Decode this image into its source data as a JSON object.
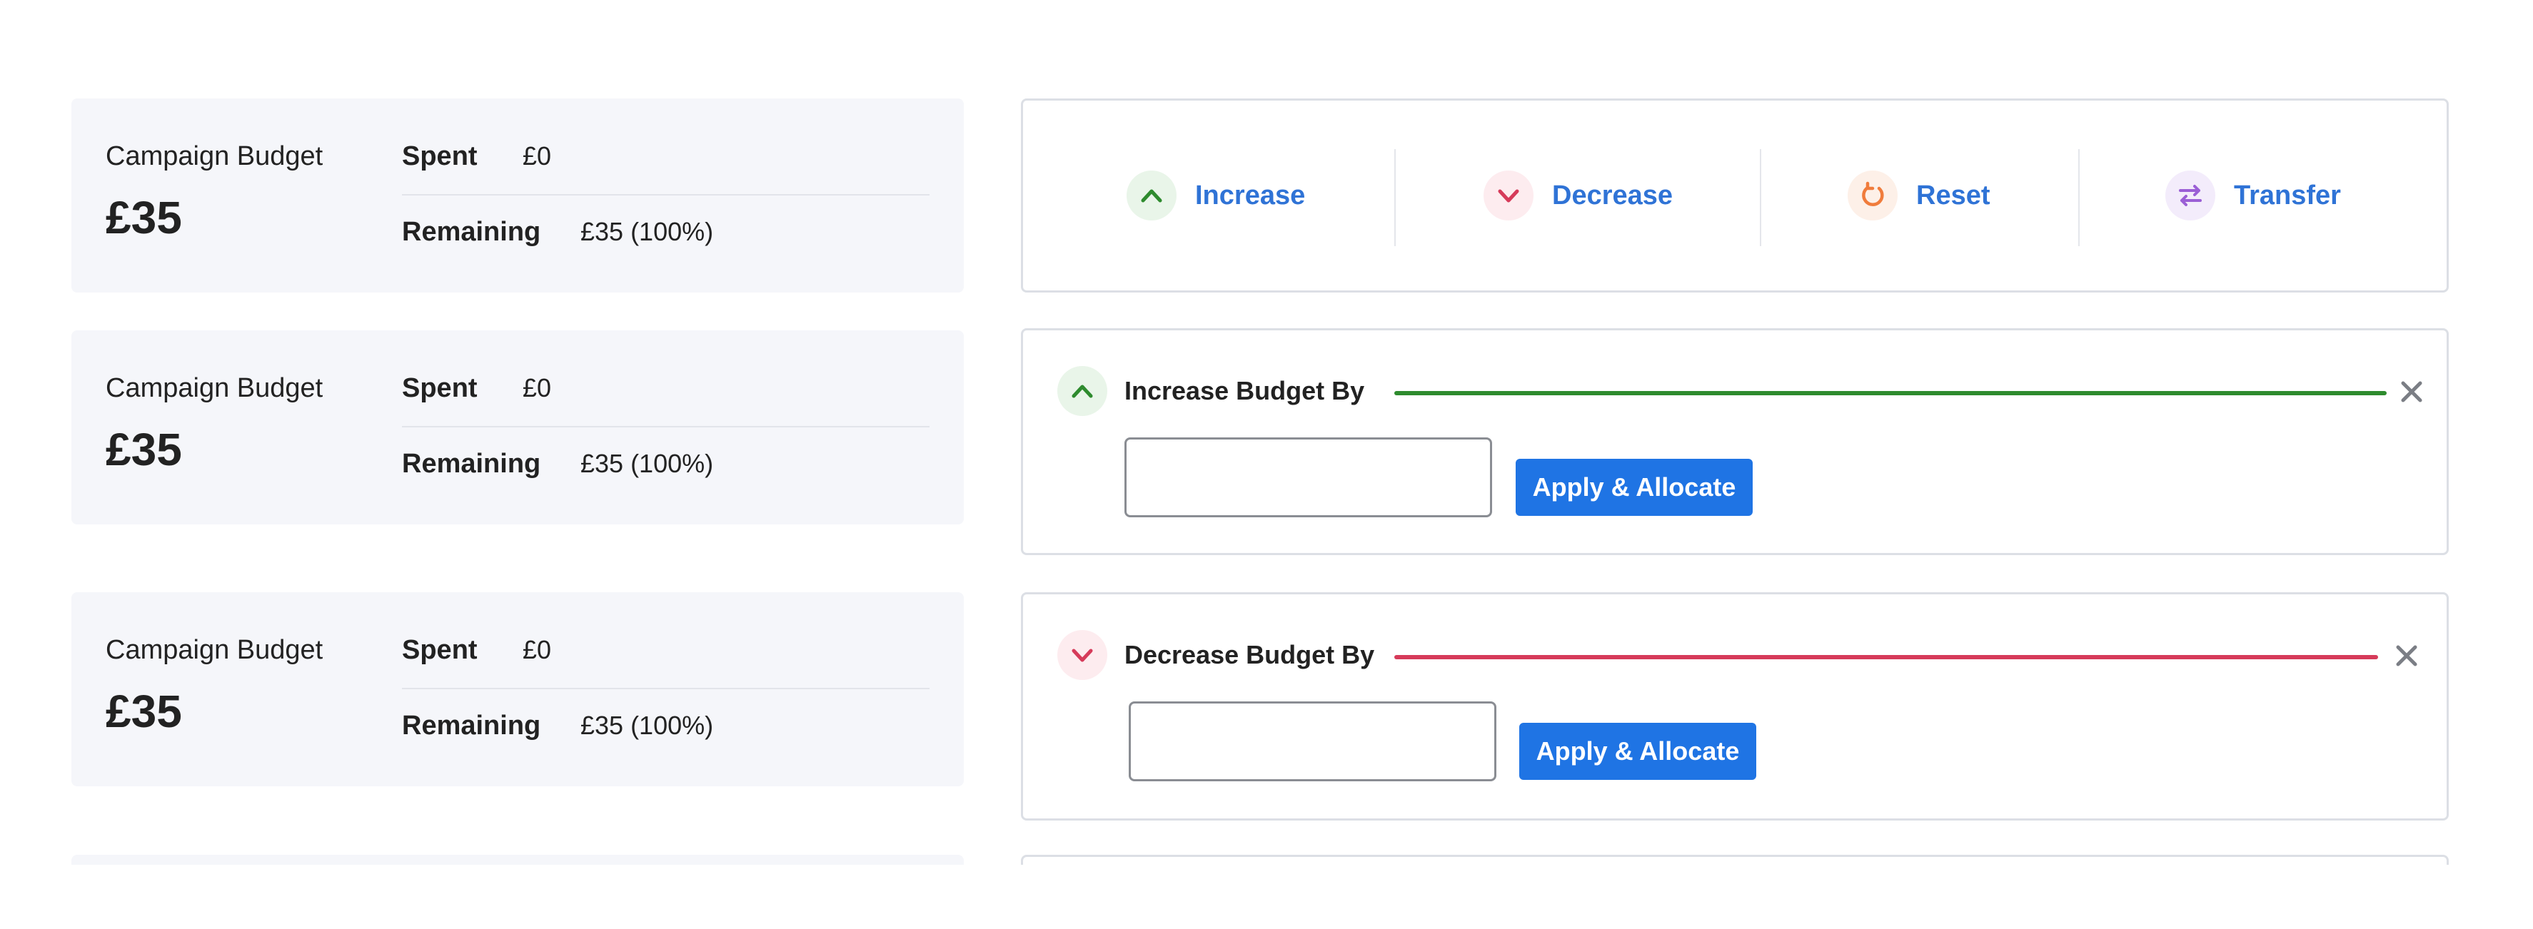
{
  "summary_card": {
    "label": "Campaign Budget",
    "amount": "£35",
    "spent_label": "Spent",
    "spent_value": "£0",
    "remaining_label": "Remaining",
    "remaining_value": "£35 (100%)"
  },
  "actions": {
    "increase": "Increase",
    "decrease": "Decrease",
    "reset": "Reset",
    "transfer": "Transfer"
  },
  "increase_form": {
    "title": "Increase Budget By",
    "input_value": "",
    "apply_label": "Apply & Allocate"
  },
  "decrease_form": {
    "title": "Decrease Budget By",
    "input_value": "",
    "apply_label": "Apply & Allocate"
  },
  "colors": {
    "increase": "#2e8b2e",
    "decrease": "#d63b5a",
    "reset": "#f07c3c",
    "transfer": "#9b5fd6",
    "link": "#2f73d6",
    "primary_button": "#1f74e4"
  },
  "icons": {
    "increase": "chevron-up-icon",
    "decrease": "chevron-down-icon",
    "reset": "refresh-icon",
    "transfer": "swap-arrows-icon",
    "close": "close-icon"
  }
}
